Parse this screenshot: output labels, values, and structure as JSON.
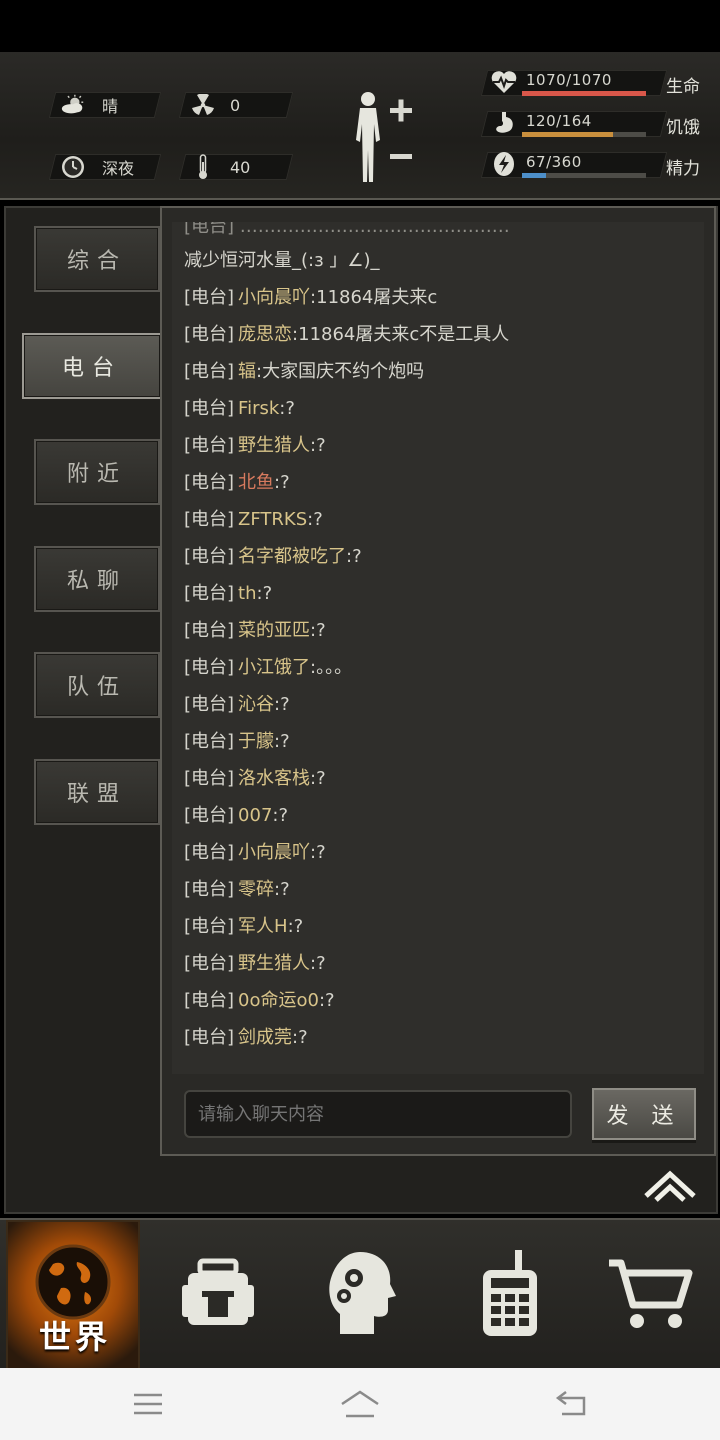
{
  "hud": {
    "weather": "晴",
    "radiation": "0",
    "time_of_day": "深夜",
    "temperature": "40"
  },
  "stats": [
    {
      "label": "生命",
      "value": "1070/1070",
      "fraction": 1.0,
      "color": "#d9574a",
      "icon": "heart-pulse-icon"
    },
    {
      "label": "饥饿",
      "value": "120/164",
      "fraction": 0.73,
      "color": "#c98f3d",
      "icon": "stomach-icon"
    },
    {
      "label": "精力",
      "value": "67/360",
      "fraction": 0.19,
      "color": "#4d8fc9",
      "icon": "energy-icon"
    }
  ],
  "tabs": [
    {
      "label": "综合"
    },
    {
      "label": "电台"
    },
    {
      "label": "附近"
    },
    {
      "label": "私聊"
    },
    {
      "label": "队伍"
    },
    {
      "label": "联盟"
    }
  ],
  "chat": {
    "partial_top": "减少恒河水量_(:з 」∠)_",
    "messages": [
      {
        "channel": "[电台]",
        "user": "小向晨吖",
        "text": ":11864屠夫来c"
      },
      {
        "channel": "[电台]",
        "user": "庞思恋",
        "text": ":11864屠夫来c不是工具人"
      },
      {
        "channel": "[电台]",
        "user": "辐",
        "text": ":大家国庆不约个炮吗"
      },
      {
        "channel": "[电台]",
        "user": "Firsk",
        "text": ":?"
      },
      {
        "channel": "[电台]",
        "user": "野生猎人",
        "text": ":?"
      },
      {
        "channel": "[电台]",
        "user": "北鱼",
        "text": ":?",
        "highlight": true
      },
      {
        "channel": "[电台]",
        "user": "ZFTRKS",
        "text": ":?"
      },
      {
        "channel": "[电台]",
        "user": "名字都被吃了",
        "text": ":?"
      },
      {
        "channel": "[电台]",
        "user": "th",
        "text": ":?"
      },
      {
        "channel": "[电台]",
        "user": "菜的亚匹",
        "text": ":?"
      },
      {
        "channel": "[电台]",
        "user": "小江饿了",
        "text": ":。。。"
      },
      {
        "channel": "[电台]",
        "user": "沁谷",
        "text": ":?"
      },
      {
        "channel": "[电台]",
        "user": "于朦",
        "text": ":?"
      },
      {
        "channel": "[电台]",
        "user": "洛水客栈",
        "text": ":?"
      },
      {
        "channel": "[电台]",
        "user": "007",
        "text": ":?"
      },
      {
        "channel": "[电台]",
        "user": "小向晨吖",
        "text": ":?"
      },
      {
        "channel": "[电台]",
        "user": "零碎",
        "text": ":?"
      },
      {
        "channel": "[电台]",
        "user": "军人H",
        "text": ":?"
      },
      {
        "channel": "[电台]",
        "user": "野生猎人",
        "text": ":?"
      },
      {
        "channel": "[电台]",
        "user": "0o命运o0",
        "text": ":?"
      },
      {
        "channel": "[电台]",
        "user": "剑成莞",
        "text": ":?"
      }
    ],
    "input_placeholder": "请输入聊天内容",
    "send_label": "发 送"
  },
  "nav": {
    "world_label": "世界",
    "items": [
      "world-icon",
      "backpack-icon",
      "skills-head-icon",
      "radio-icon",
      "cart-icon"
    ]
  }
}
